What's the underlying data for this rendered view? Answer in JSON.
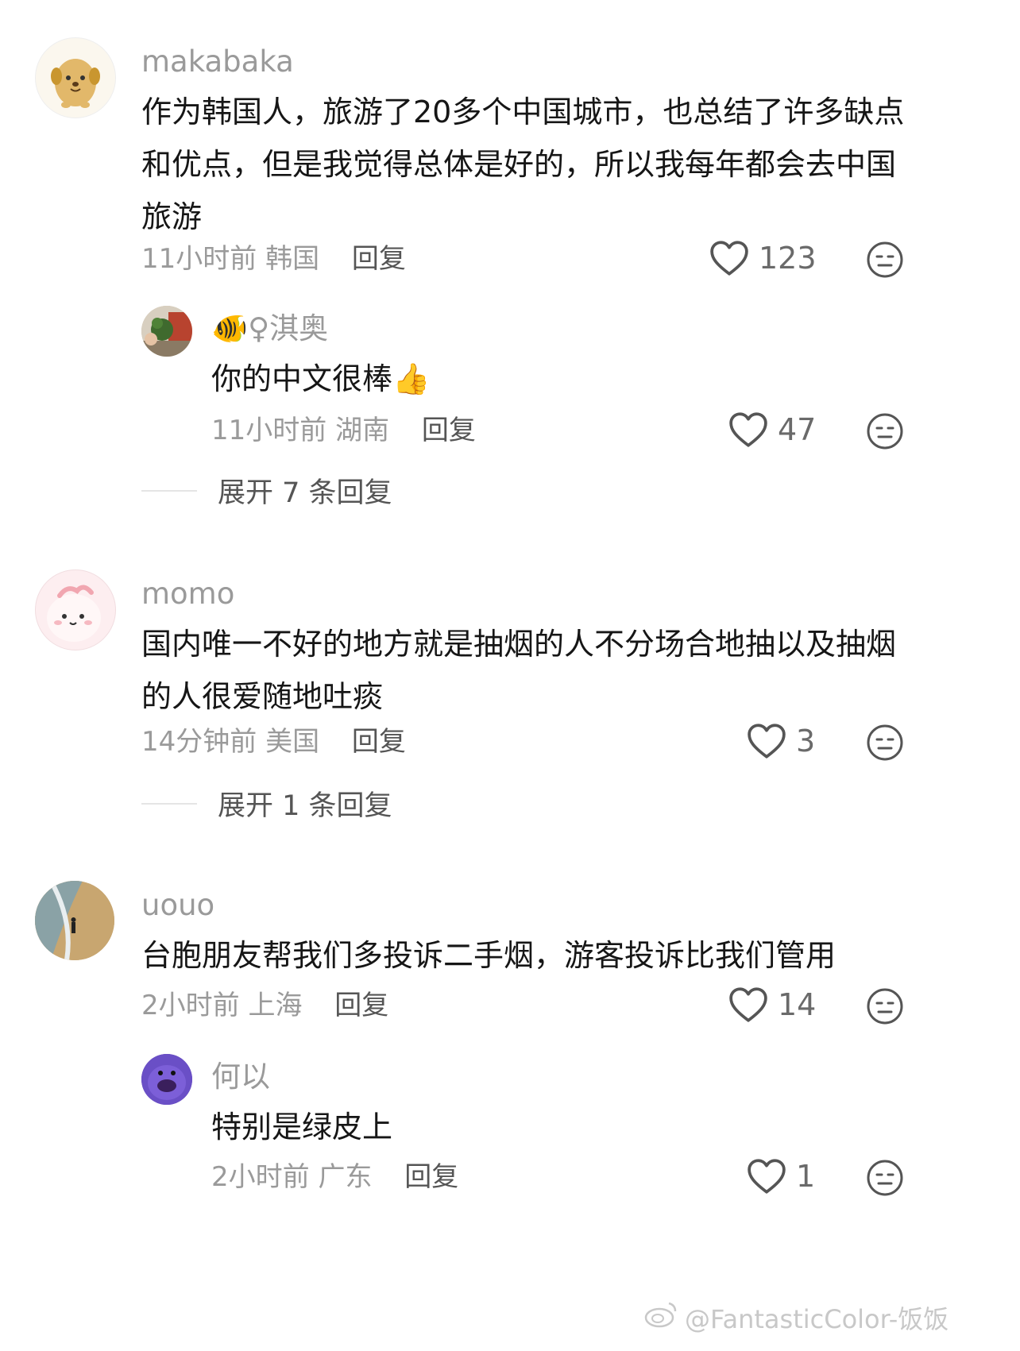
{
  "comments": [
    {
      "username": "makabaka",
      "text": "作为韩国人，旅游了20多个中国城市，也总结了许多缺点和优点，但是我觉得总体是好的，所以我每年都会去中国旅游",
      "time": "11小时前",
      "location": "韩国",
      "reply_label": "回复",
      "likes": "123",
      "replies": [
        {
          "username": "🐠♀淇奥",
          "text": "你的中文很棒👍",
          "time": "11小时前",
          "location": "湖南",
          "reply_label": "回复",
          "likes": "47"
        }
      ],
      "expand_label": "展开 7 条回复"
    },
    {
      "username": "momo",
      "text": "国内唯一不好的地方就是抽烟的人不分场合地抽以及抽烟的人很爱随地吐痰",
      "time": "14分钟前",
      "location": "美国",
      "reply_label": "回复",
      "likes": "3",
      "expand_label": "展开 1 条回复"
    },
    {
      "username": "uouo",
      "text": "台胞朋友帮我们多投诉二手烟，游客投诉比我们管用",
      "time": "2小时前",
      "location": "上海",
      "reply_label": "回复",
      "likes": "14",
      "replies": [
        {
          "username": "何以",
          "text": "特别是绿皮上",
          "time": "2小时前",
          "location": "广东",
          "reply_label": "回复",
          "likes": "1"
        }
      ]
    }
  ],
  "watermark": "@FantasticColor-饭饭",
  "icons": {
    "like": "heart-outline-icon",
    "dislike": "neutral-face-icon",
    "watermark": "weibo-logo-icon"
  }
}
